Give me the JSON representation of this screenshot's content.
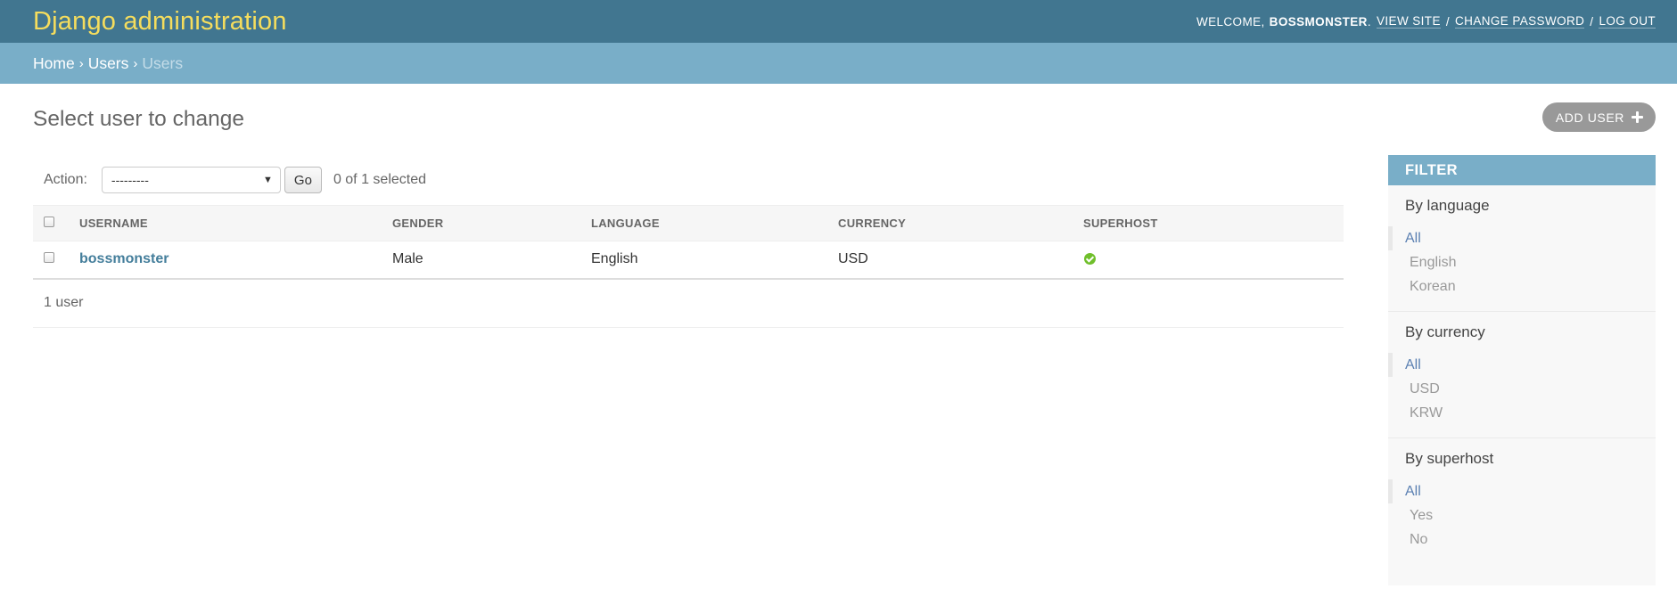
{
  "header": {
    "branding": "Django administration",
    "welcome": "WELCOME,",
    "username": "BOSSMONSTER",
    "user_suffix": ".",
    "links": [
      "VIEW SITE",
      "CHANGE PASSWORD",
      "LOG OUT"
    ],
    "separator": "/"
  },
  "breadcrumbs": {
    "items": [
      "Home",
      "Users"
    ],
    "current": "Users",
    "separator": "›"
  },
  "page": {
    "title": "Select user to change",
    "add_button": "ADD USER"
  },
  "actions": {
    "label": "Action:",
    "select_value": "---------",
    "go_button": "Go",
    "selection_count": "0 of 1 selected"
  },
  "table": {
    "headers": [
      "USERNAME",
      "GENDER",
      "LANGUAGE",
      "CURRENCY",
      "SUPERHOST"
    ],
    "rows": [
      {
        "username": "bossmonster",
        "gender": "Male",
        "language": "English",
        "currency": "USD",
        "superhost_icon": "check-circle-icon"
      }
    ]
  },
  "paginator": {
    "text": "1 user"
  },
  "filter": {
    "title": "FILTER",
    "groups": [
      {
        "heading": "By language",
        "options": [
          "All",
          "English",
          "Korean"
        ],
        "selected": "All"
      },
      {
        "heading": "By currency",
        "options": [
          "All",
          "USD",
          "KRW"
        ],
        "selected": "All"
      },
      {
        "heading": "By superhost",
        "options": [
          "All",
          "Yes",
          "No"
        ],
        "selected": "All"
      }
    ]
  },
  "colors": {
    "header_bg": "#417690",
    "branding": "#f5dd5d",
    "breadcrumbs_bg": "#79aec8",
    "link": "#447e9b",
    "selected_filter": "#5b80b2",
    "success": "#70bf2b"
  }
}
